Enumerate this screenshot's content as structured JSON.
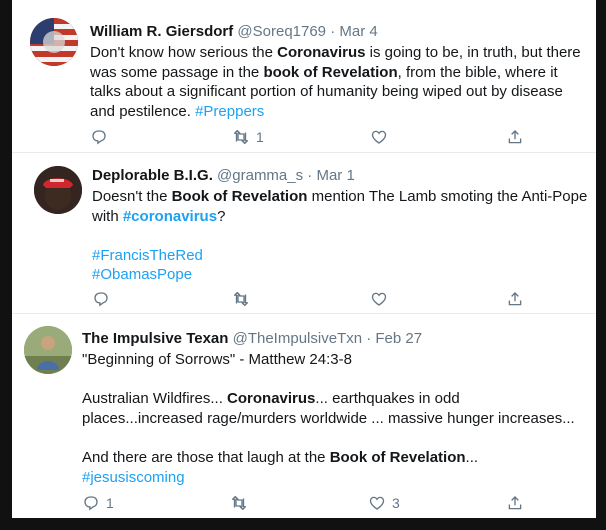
{
  "tweets": [
    {
      "name": "William R. Giersdorf",
      "handle": "@Soreq1769",
      "dot": "·",
      "date": "Mar 4",
      "body": {
        "l1a": "Don't know how serious the ",
        "l1b": "Coronavirus",
        "l1c": " is going to be, in truth, but there",
        "l2a": "was some passage in the ",
        "l2b": "book of Revelation",
        "l2c": ", from the bible, where it",
        "l3": "talks about a significant portion of humanity being wiped out by disease",
        "l4a": "and pestilence. ",
        "l4b": "#Preppers"
      },
      "replies": "",
      "retweets": "1",
      "likes": ""
    },
    {
      "name": "Deplorable B.I.G.",
      "handle": "@gramma_s",
      "dot": "·",
      "date": "Mar 1",
      "body": {
        "l1a": "Doesn't the ",
        "l1b": "Book of Revelation",
        "l1c": " mention The Lamb smoting the Anti-Pope",
        "l2a": "with ",
        "l2b": "#coronavirus",
        "l2c": "?",
        "l3": "#FrancisTheRed",
        "l4": "#ObamasPope"
      },
      "replies": "",
      "retweets": "",
      "likes": ""
    },
    {
      "name": "The Impulsive Texan",
      "handle": "@TheImpulsiveTxn",
      "dot": "·",
      "date": "Feb 27",
      "body": {
        "l1": "\"Beginning of Sorrows\" - Matthew 24:3-8",
        "l2a": "Australian Wildfires... ",
        "l2b": "Coronavirus",
        "l2c": "... earthquakes in odd",
        "l3": "places...increased rage/murders worldwide ... massive hunger increases...",
        "l4a": "And there are those that laugh at the ",
        "l4b": "Book of Revelation",
        "l4c": "...",
        "l5": "#jesusiscoming"
      },
      "replies": "1",
      "retweets": "",
      "likes": "3"
    }
  ],
  "icons": [
    "reply-icon",
    "retweet-icon",
    "like-icon",
    "share-icon"
  ],
  "colors": {
    "link": "#1da1f2",
    "text": "#14171a",
    "muted": "#657786"
  }
}
